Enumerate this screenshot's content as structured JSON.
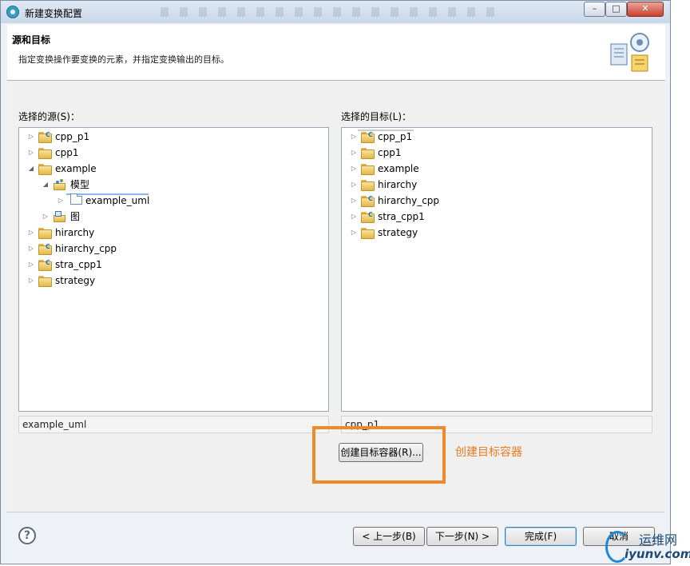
{
  "window": {
    "title": "新建变换配置"
  },
  "header": {
    "title": "源和目标",
    "description": "指定变换操作要变换的元素，并指定变换输出的目标。"
  },
  "source": {
    "label": "选择的源(S)：",
    "items": [
      {
        "label": "cpp_p1",
        "icon": "c-project-folder-icon",
        "expander": "collapsed"
      },
      {
        "label": "cpp1",
        "icon": "project-folder-icon",
        "expander": "collapsed"
      },
      {
        "label": "example",
        "icon": "project-folder-icon",
        "expander": "expanded"
      },
      {
        "label": "模型",
        "icon": "model-folder-icon",
        "expander": "expanded"
      },
      {
        "label": "example_uml",
        "icon": "package-icon",
        "expander": "collapsed",
        "selected": true
      },
      {
        "label": "图",
        "icon": "diagram-folder-icon",
        "expander": "collapsed"
      },
      {
        "label": "hirarchy",
        "icon": "project-folder-icon",
        "expander": "collapsed"
      },
      {
        "label": "hirarchy_cpp",
        "icon": "c-project-folder-icon",
        "expander": "collapsed"
      },
      {
        "label": "stra_cpp1",
        "icon": "c-project-folder-icon",
        "expander": "collapsed"
      },
      {
        "label": "strategy",
        "icon": "project-folder-icon",
        "expander": "collapsed"
      }
    ],
    "status": "example_uml"
  },
  "target": {
    "label": "选择的目标(L)：",
    "items": [
      {
        "label": "cpp_p1",
        "icon": "c-project-folder-icon",
        "selected": true
      },
      {
        "label": "cpp1",
        "icon": "project-folder-icon"
      },
      {
        "label": "example",
        "icon": "project-folder-icon"
      },
      {
        "label": "hirarchy",
        "icon": "project-folder-icon"
      },
      {
        "label": "hirarchy_cpp",
        "icon": "c-project-folder-icon"
      },
      {
        "label": "stra_cpp1",
        "icon": "c-project-folder-icon"
      },
      {
        "label": "strategy",
        "icon": "project-folder-icon"
      }
    ],
    "status": "cpp_p1"
  },
  "create_container_button": "创建目标容器(R)...",
  "annotation": "创建目标容器",
  "buttons": {
    "back": "< 上一步(B)",
    "next": "下一步(N) >",
    "finish": "完成(F)",
    "cancel": "取消"
  },
  "watermark": {
    "line1": "运维网",
    "line2": "iyunv.com"
  },
  "colors": {
    "annotation": "#ec7b1d",
    "highlight_box": "#ef8a2a",
    "selection": "#ddeefc"
  }
}
